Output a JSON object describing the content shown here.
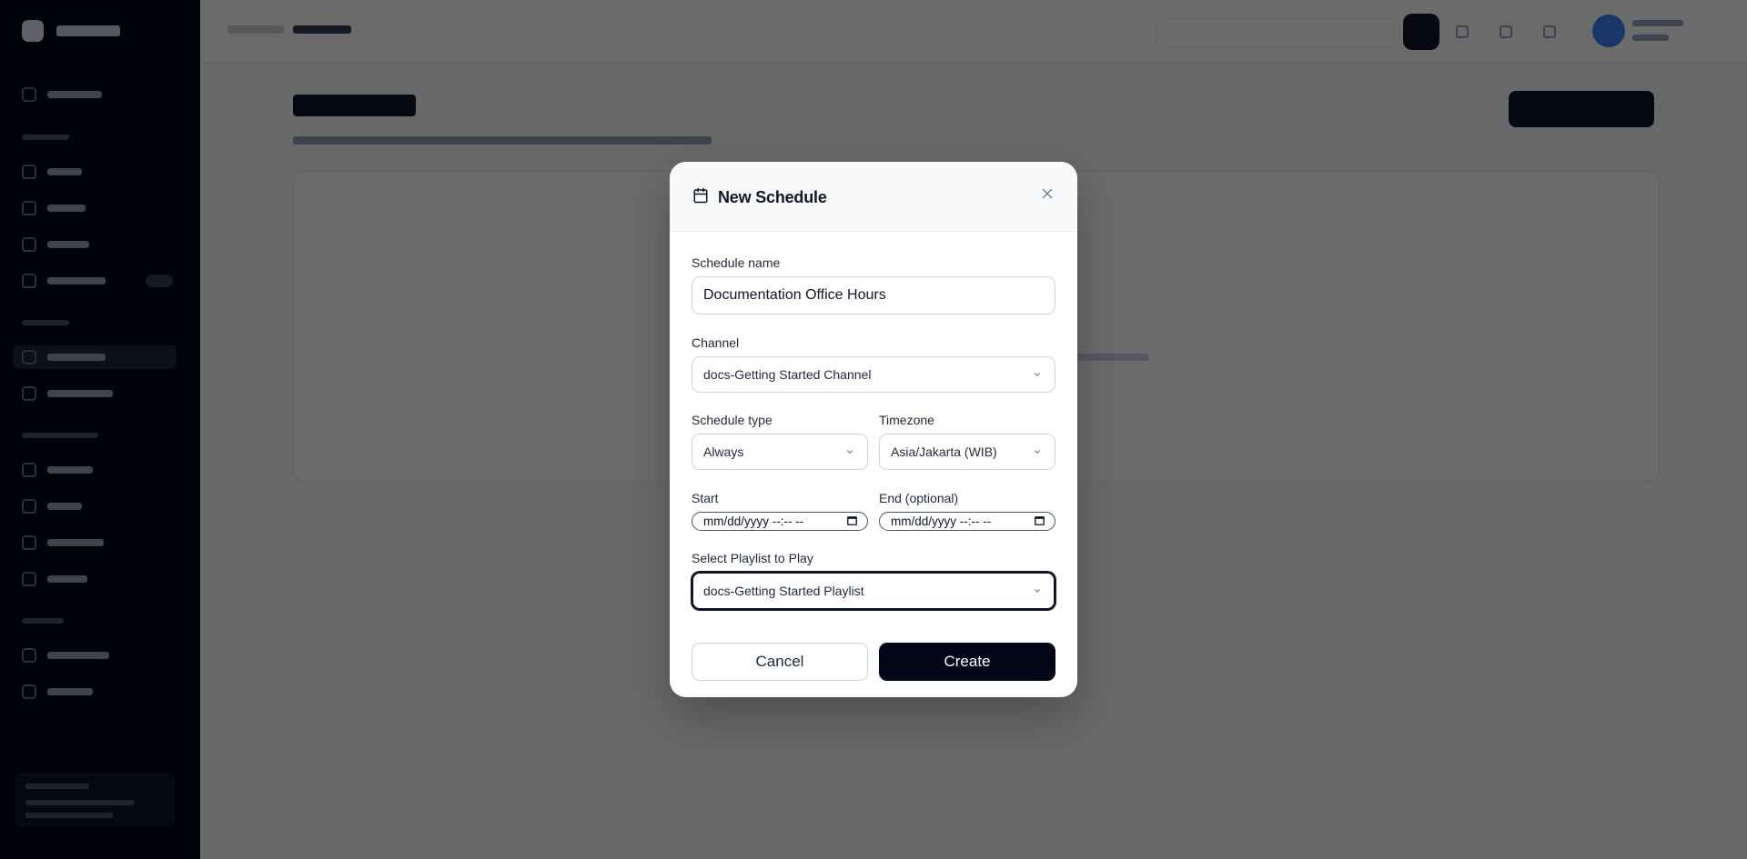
{
  "modal": {
    "title": "New Schedule",
    "title_icon": "calendar-icon",
    "close_icon": "close-icon",
    "fields": {
      "schedule_name": {
        "label": "Schedule name",
        "value": "Documentation Office Hours"
      },
      "channel": {
        "label": "Channel",
        "value": "docs-Getting Started Channel"
      },
      "schedule_type": {
        "label": "Schedule type",
        "value": "Always"
      },
      "timezone": {
        "label": "Timezone",
        "value": "Asia/Jakarta (WIB)"
      },
      "start": {
        "label": "Start",
        "placeholder": "mm/dd/yyyy --:-- --"
      },
      "end": {
        "label": "End (optional)",
        "placeholder": "mm/dd/yyyy --:-- --"
      },
      "playlist": {
        "label": "Select Playlist to Play",
        "value": "docs-Getting Started Playlist"
      }
    },
    "buttons": {
      "cancel": "Cancel",
      "create": "Create"
    }
  },
  "colors": {
    "primary": "#020617",
    "overlay": "rgba(0,0,0,0.58)",
    "border": "#cbd5e1"
  }
}
